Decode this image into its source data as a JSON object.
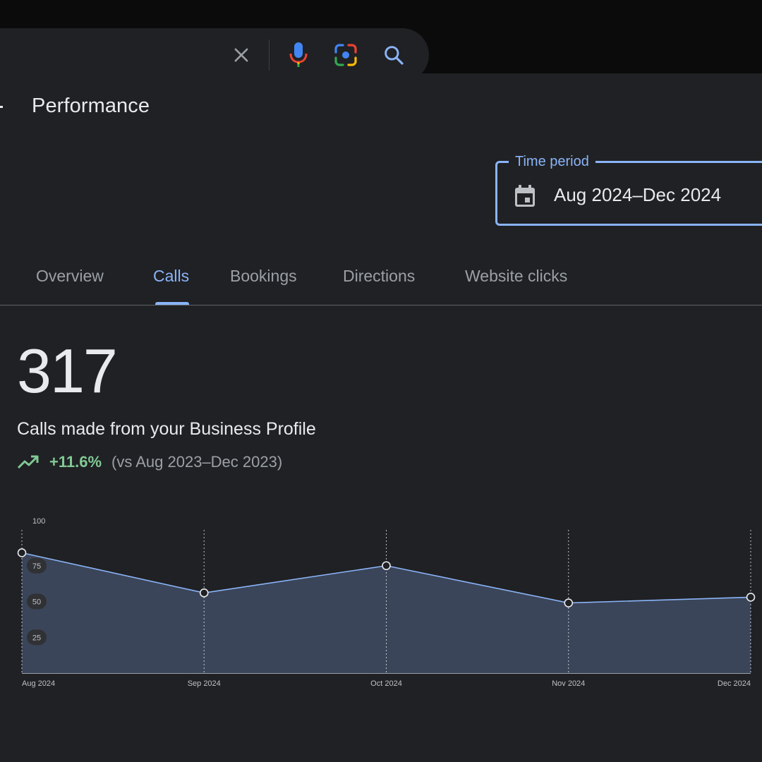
{
  "search": {
    "clear_icon": "close-icon",
    "mic_icon": "mic-icon",
    "lens_icon": "lens-icon",
    "search_icon": "search-icon"
  },
  "header": {
    "title": "Performance"
  },
  "time_period": {
    "label": "Time period",
    "value": "Aug 2024–Dec 2024"
  },
  "tabs": [
    {
      "label": "Overview",
      "active": false
    },
    {
      "label": "Calls",
      "active": true
    },
    {
      "label": "Bookings",
      "active": false
    },
    {
      "label": "Directions",
      "active": false
    },
    {
      "label": "Website clicks",
      "active": false
    }
  ],
  "metric": {
    "value": "317",
    "description": "Calls made from your Business Profile",
    "change": "+11.6%",
    "comparison": "(vs Aug 2023–Dec 2023)"
  },
  "colors": {
    "accent": "#8ab4f8",
    "positive": "#81c995",
    "background": "#202124"
  },
  "chart_data": {
    "type": "area",
    "x": [
      "Aug 2024",
      "Sep 2024",
      "Oct 2024",
      "Nov 2024",
      "Dec 2024"
    ],
    "values": [
      84,
      56,
      75,
      49,
      53
    ],
    "y_ticks": [
      "100",
      "75",
      "50",
      "25"
    ],
    "ylim": [
      0,
      100
    ],
    "grid": "vertical-dotted"
  }
}
